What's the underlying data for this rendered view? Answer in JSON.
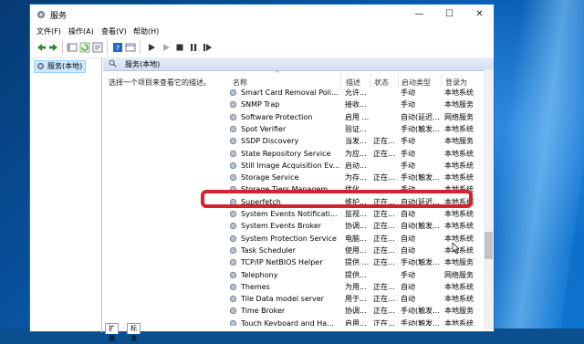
{
  "window": {
    "title": "服务",
    "minimize": "—",
    "maximize": "☐",
    "close": "✕"
  },
  "menu": [
    "文件(F)",
    "操作(A)",
    "查看(V)",
    "帮助(H)"
  ],
  "toolbar_icons": [
    "back-icon",
    "forward-icon",
    "console-tree-icon",
    "refresh-icon",
    "export-icon",
    "help-icon",
    "properties-icon",
    "start-service-icon",
    "play-icon",
    "stop-icon",
    "pause-icon",
    "restart-icon"
  ],
  "tree": {
    "item_label": "服务(本地)"
  },
  "pane": {
    "title": "服务(本地)",
    "description": "选择一个项目来查看它的描述。"
  },
  "columns": [
    "名称",
    "描述",
    "状态",
    "启动类型",
    "登录为"
  ],
  "services": [
    {
      "name": "Smart Card Removal Poli...",
      "desc": "允许...",
      "status": "",
      "start": "手动",
      "logon": "本地系统"
    },
    {
      "name": "SNMP Trap",
      "desc": "接收...",
      "status": "",
      "start": "手动",
      "logon": "本地服务"
    },
    {
      "name": "Software Protection",
      "desc": "启用 ...",
      "status": "",
      "start": "自动(延迟...",
      "logon": "网络服务"
    },
    {
      "name": "Spot Verifier",
      "desc": "验证...",
      "status": "",
      "start": "手动(触发...",
      "logon": "本地系统"
    },
    {
      "name": "SSDP Discovery",
      "desc": "当发...",
      "status": "正在...",
      "start": "手动",
      "logon": "本地服务"
    },
    {
      "name": "State Repository Service",
      "desc": "为应...",
      "status": "正在...",
      "start": "手动",
      "logon": "本地系统"
    },
    {
      "name": "Still Image Acquisition Ev...",
      "desc": "启动...",
      "status": "",
      "start": "手动",
      "logon": "本地系统"
    },
    {
      "name": "Storage Service",
      "desc": "为存...",
      "status": "正在...",
      "start": "手动(触发...",
      "logon": "本地系统"
    },
    {
      "name": "Storage Tiers Managem...",
      "desc": "优化...",
      "status": "",
      "start": "手动",
      "logon": "本地系统"
    },
    {
      "name": "Superfetch",
      "desc": "维护...",
      "status": "正在...",
      "start": "自动(延迟...",
      "logon": "本地系统"
    },
    {
      "name": "System Events Notificati...",
      "desc": "监视...",
      "status": "正在...",
      "start": "自动",
      "logon": "本地系统"
    },
    {
      "name": "System Events Broker",
      "desc": "协调...",
      "status": "正在...",
      "start": "自动(触发...",
      "logon": "本地系统"
    },
    {
      "name": "System Protection Service",
      "desc": "电脑...",
      "status": "正在...",
      "start": "自动",
      "logon": "本地系统"
    },
    {
      "name": "Task Scheduler",
      "desc": "使用...",
      "status": "正在...",
      "start": "自动",
      "logon": "本地系统"
    },
    {
      "name": "TCP/IP NetBIOS Helper",
      "desc": "提供 ...",
      "status": "正在...",
      "start": "手动(触发...",
      "logon": "本地服务"
    },
    {
      "name": "Telephony",
      "desc": "提供...",
      "status": "",
      "start": "手动",
      "logon": "网络服务"
    },
    {
      "name": "Themes",
      "desc": "为用...",
      "status": "正在...",
      "start": "自动",
      "logon": "本地系统"
    },
    {
      "name": "Tile Data model server",
      "desc": "用于...",
      "status": "正在...",
      "start": "自动",
      "logon": "本地系统"
    },
    {
      "name": "Time Broker",
      "desc": "协调...",
      "status": "正在...",
      "start": "手动(触发...",
      "logon": "本地服务"
    },
    {
      "name": "Touch Keyboard and Ha...",
      "desc": "启用...",
      "status": "正在...",
      "start": "手动(触发...",
      "logon": "本地系统"
    }
  ],
  "bottom_tabs": [
    "扩展",
    "标准"
  ],
  "colors": {
    "highlight": "#d9202c",
    "accent": "#1a6fc3"
  }
}
